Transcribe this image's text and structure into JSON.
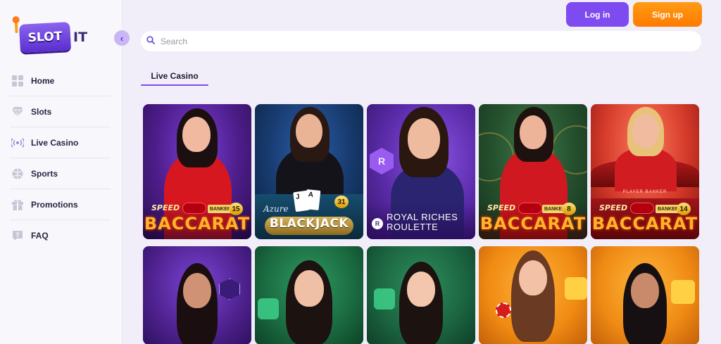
{
  "brand": {
    "logo_text": "SLOT",
    "logo_suffix": "IT"
  },
  "header": {
    "login_label": "Log in",
    "signup_label": "Sign up"
  },
  "search": {
    "placeholder": "Search"
  },
  "sidebar": {
    "items": [
      {
        "label": "Home",
        "icon": "grid-icon"
      },
      {
        "label": "Slots",
        "icon": "gem-icon"
      },
      {
        "label": "Live Casino",
        "icon": "broadcast-icon"
      },
      {
        "label": "Sports",
        "icon": "ball-icon"
      },
      {
        "label": "Promotions",
        "icon": "gift-icon"
      },
      {
        "label": "FAQ",
        "icon": "question-icon"
      }
    ]
  },
  "section": {
    "tab_label": "Live Casino"
  },
  "games": [
    {
      "title": "BACCARAT",
      "prefix": "SPEED",
      "number": "15",
      "tag": "BANKER"
    },
    {
      "title": "BLACKJACK",
      "prefix": "Azure",
      "number": "31"
    },
    {
      "title": "ROYAL RICHES ROULETTE"
    },
    {
      "title": "BACCARAT",
      "prefix": "SPEED",
      "number": "8",
      "tag": "BANKER"
    },
    {
      "title": "BACCARAT",
      "prefix": "SPEED",
      "number": "14",
      "tag": "BANKER",
      "sub": "PLAYER  BANKER"
    }
  ],
  "colors": {
    "accent": "#7d4bf0",
    "signup": "#ff8a0a",
    "background": "#f1eef9"
  }
}
